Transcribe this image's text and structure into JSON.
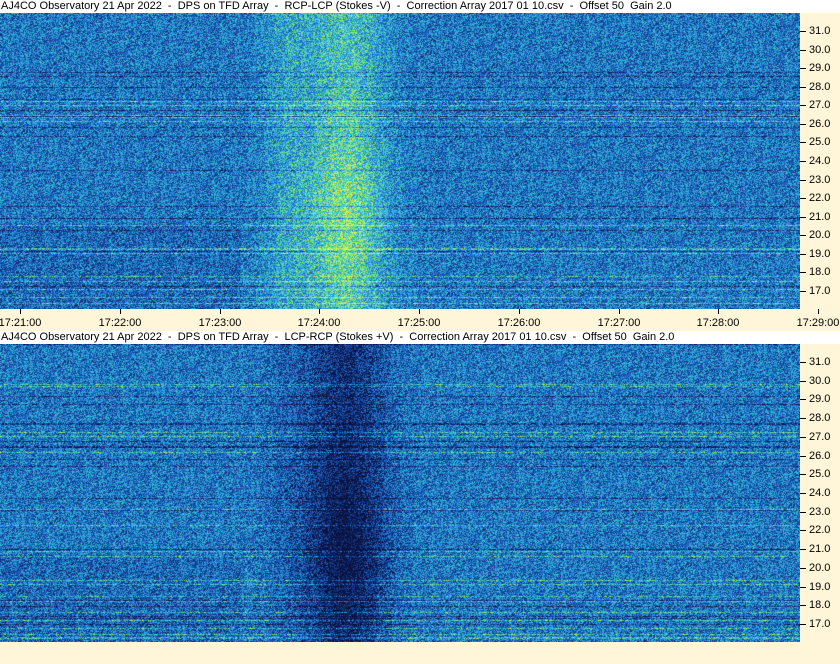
{
  "panels": [
    {
      "title": "AJ4CO Observatory 21 Apr 2022  -  DPS on TFD Array  -  RCP-LCP (Stokes -V)  -  Correction Array 2017 01 10.csv  -  Offset 50  Gain 2.0",
      "polarity": "negative",
      "freq_labels": [
        "31.0",
        "30.0",
        "29.0",
        "28.0",
        "27.0",
        "26.0",
        "25.0",
        "24.0",
        "23.0",
        "22.0",
        "21.0",
        "20.0",
        "19.0",
        "18.0",
        "17.0"
      ]
    },
    {
      "title": "AJ4CO Observatory 21 Apr 2022  -  DPS on TFD Array  -  LCP-RCP (Stokes +V)  -  Correction Array 2017 01 10.csv  -  Offset 50  Gain 2.0",
      "polarity": "positive",
      "freq_labels": [
        "31.0",
        "30.0",
        "29.0",
        "28.0",
        "27.0",
        "26.0",
        "25.0",
        "24.0",
        "23.0",
        "22.0",
        "21.0",
        "20.0",
        "19.0",
        "18.0",
        "17.0"
      ]
    }
  ],
  "time_axis": {
    "labels": [
      "17:21:00",
      "17:22:00",
      "17:23:00",
      "17:24:00",
      "17:25:00",
      "17:26:00",
      "17:27:00",
      "17:28:00",
      "17:29:00"
    ]
  },
  "colors": {
    "axis_background": "#fff6d9",
    "colormap": [
      "#0a1240",
      "#123a8c",
      "#1e64c8",
      "#2aa0dc",
      "#40d0c8",
      "#a0f060",
      "#f0f040"
    ]
  }
}
